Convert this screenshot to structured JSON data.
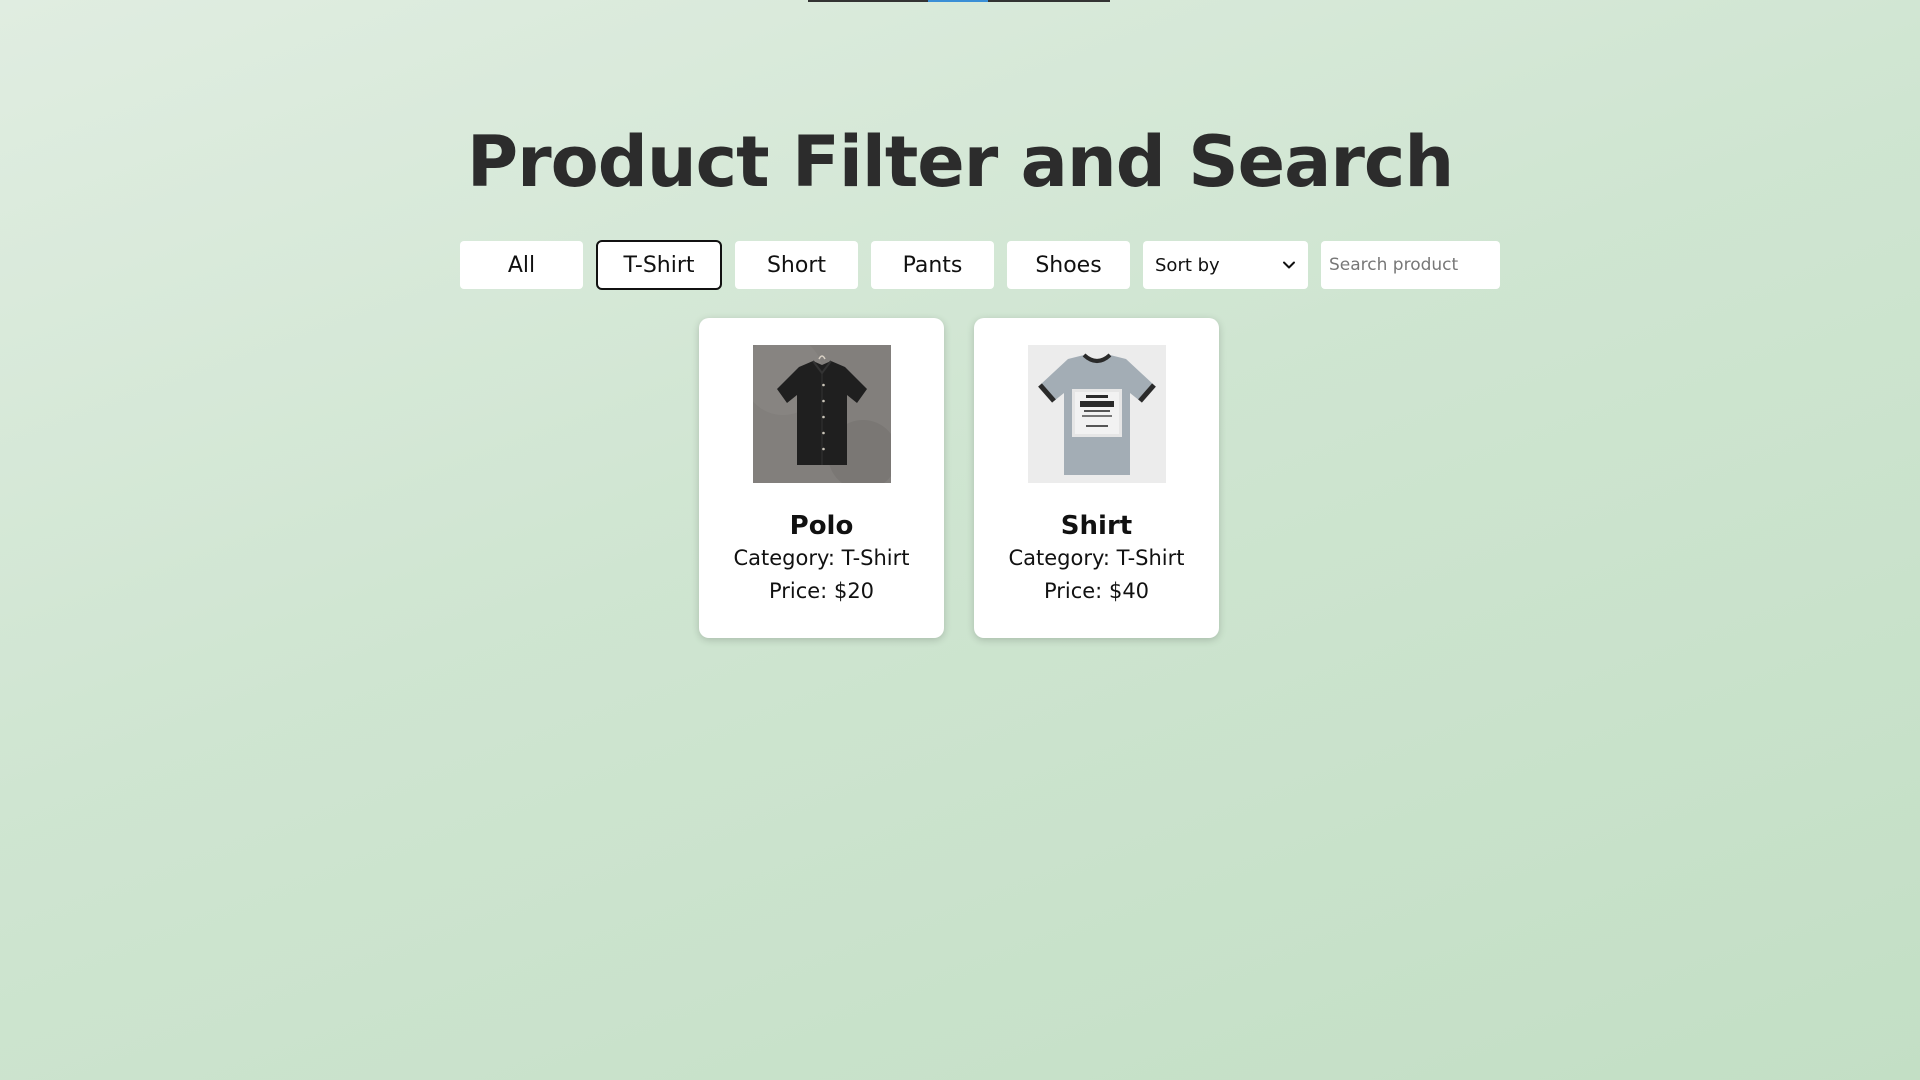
{
  "page": {
    "title": "Product Filter and Search"
  },
  "filters": {
    "buttons": [
      "All",
      "T-Shirt",
      "Short",
      "Pants",
      "Shoes"
    ],
    "active": "T-Shirt",
    "sort_label": "Sort by",
    "search_placeholder": "Search product"
  },
  "products": [
    {
      "name": "Polo",
      "category_label": "Category:",
      "category": "T-Shirt",
      "price_label": "Price:",
      "price": "$20",
      "image_icon": "black-button-shirt-image"
    },
    {
      "name": "Shirt",
      "category_label": "Category:",
      "category": "T-Shirt",
      "price_label": "Price:",
      "price": "$40",
      "image_icon": "grey-ringer-tshirt-image"
    }
  ],
  "colors": {
    "background_top": "#e0ede1",
    "background_bottom": "#c3dfc5",
    "card": "#ffffff",
    "title": "#2c2c2c",
    "accent": "#3a8fd6"
  }
}
